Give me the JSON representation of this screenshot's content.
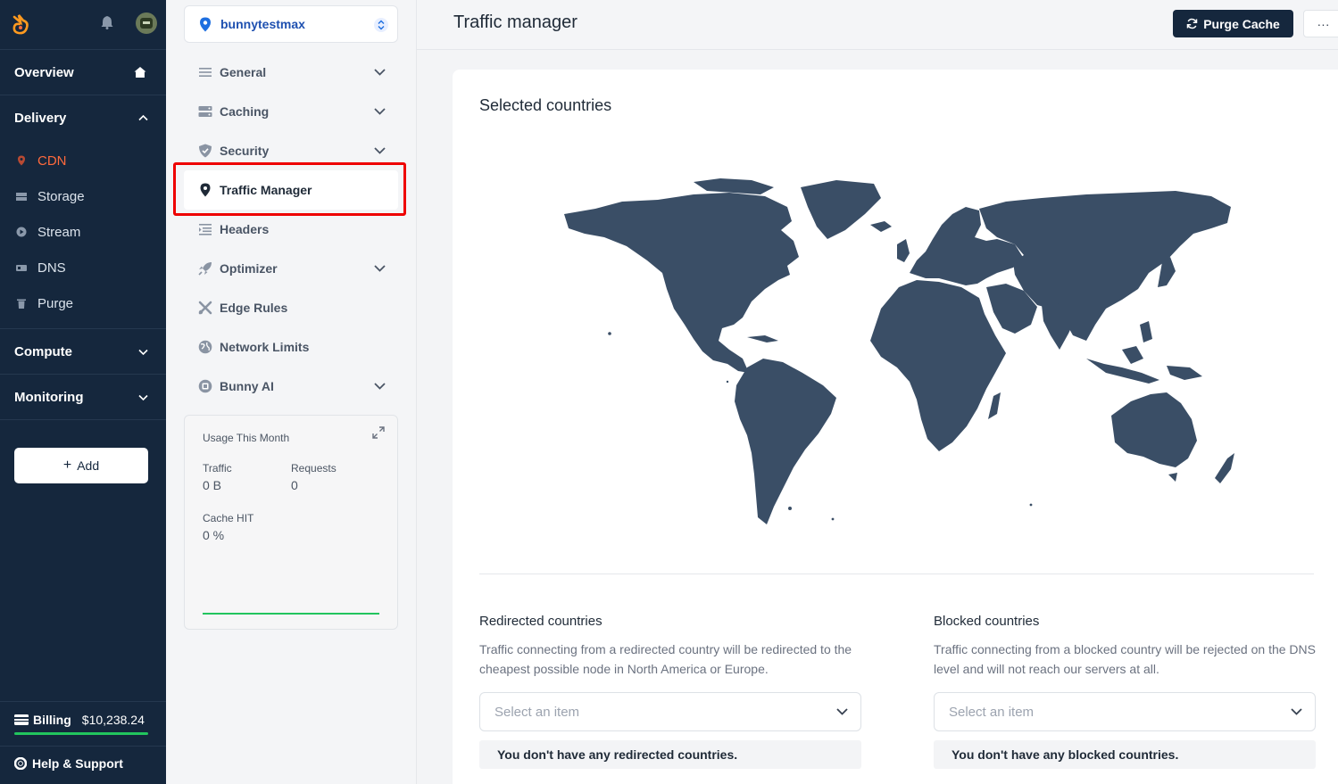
{
  "sidebar": {
    "sections": {
      "overview": "Overview",
      "delivery": "Delivery",
      "compute": "Compute",
      "monitoring": "Monitoring"
    },
    "delivery_items": [
      {
        "label": "CDN",
        "icon": "map-pin-icon",
        "active": true
      },
      {
        "label": "Storage",
        "icon": "storage-icon"
      },
      {
        "label": "Stream",
        "icon": "play-icon"
      },
      {
        "label": "DNS",
        "icon": "dns-icon"
      },
      {
        "label": "Purge",
        "icon": "trash-icon"
      }
    ],
    "add_label": "Add",
    "billing_label": "Billing",
    "billing_amount": "$10,238.24",
    "help_label": "Help & Support"
  },
  "subnav": {
    "zone": "bunnytestmax",
    "items": [
      {
        "label": "General",
        "icon": "list-icon",
        "has_children": true
      },
      {
        "label": "Caching",
        "icon": "server-icon",
        "has_children": true
      },
      {
        "label": "Security",
        "icon": "shield-icon",
        "has_children": true
      },
      {
        "label": "Traffic Manager",
        "icon": "map-pin-icon",
        "active": true
      },
      {
        "label": "Headers",
        "icon": "headers-icon"
      },
      {
        "label": "Optimizer",
        "icon": "rocket-icon",
        "has_children": true
      },
      {
        "label": "Edge Rules",
        "icon": "tools-icon"
      },
      {
        "label": "Network Limits",
        "icon": "globe-icon"
      },
      {
        "label": "Bunny AI",
        "icon": "ai-chip-icon",
        "has_children": true
      }
    ],
    "usage": {
      "title": "Usage This Month",
      "traffic_label": "Traffic",
      "traffic_value": "0 B",
      "requests_label": "Requests",
      "requests_value": "0",
      "cache_label": "Cache HIT",
      "cache_value": "0 %"
    }
  },
  "header": {
    "title": "Traffic manager",
    "purge_label": "Purge Cache",
    "more_label": "···"
  },
  "main": {
    "selected_title": "Selected countries",
    "redirected": {
      "title": "Redirected countries",
      "desc": "Traffic connecting from a redirected country will be redirected to the cheapest possible node in North America or Europe.",
      "placeholder": "Select an item",
      "empty": "You don't have any redirected countries."
    },
    "blocked": {
      "title": "Blocked countries",
      "desc": "Traffic connecting from a blocked country will be rejected on the DNS level and will not reach our servers at all.",
      "placeholder": "Select an item",
      "empty": "You don't have any blocked countries."
    }
  },
  "colors": {
    "sidebar_bg": "#15273d",
    "accent": "#ff6a3d",
    "map_fill": "#3a4e66",
    "success": "#22c55e",
    "highlight": "#ee0000"
  }
}
